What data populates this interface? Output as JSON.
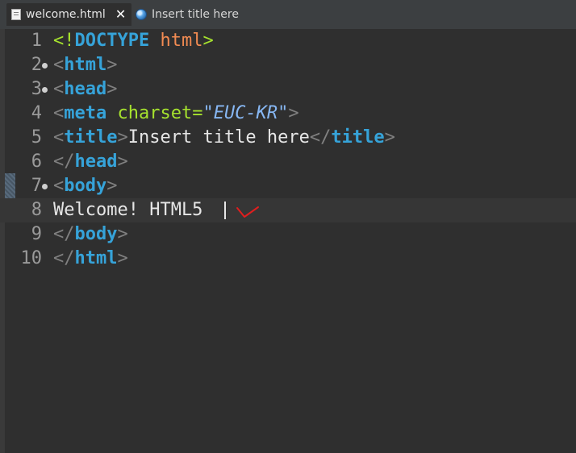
{
  "tabs": [
    {
      "label": "welcome.html",
      "active": true,
      "icon": "file-icon"
    },
    {
      "label": "Insert title here",
      "active": false,
      "icon": "globe-icon"
    }
  ],
  "editor": {
    "lines": [
      {
        "num": "1",
        "tokens": [
          [
            "c-bracket-green",
            "<!"
          ],
          [
            "c-tag",
            "DOCTYPE"
          ],
          [
            "c-text",
            " "
          ],
          [
            "c-kw-orange",
            "html"
          ],
          [
            "c-bracket-green",
            ">"
          ]
        ]
      },
      {
        "num": "2",
        "fold": true,
        "tokens": [
          [
            "c-bracket",
            "<"
          ],
          [
            "c-tag",
            "html"
          ],
          [
            "c-bracket",
            ">"
          ]
        ]
      },
      {
        "num": "3",
        "fold": true,
        "tokens": [
          [
            "c-bracket",
            "<"
          ],
          [
            "c-tag",
            "head"
          ],
          [
            "c-bracket",
            ">"
          ]
        ]
      },
      {
        "num": "4",
        "tokens": [
          [
            "c-bracket",
            "<"
          ],
          [
            "c-tag",
            "meta"
          ],
          [
            "c-text",
            " "
          ],
          [
            "c-attr",
            "charset"
          ],
          [
            "c-attr",
            "="
          ],
          [
            "c-val",
            "\"EUC-KR\""
          ],
          [
            "c-bracket",
            ">"
          ]
        ]
      },
      {
        "num": "5",
        "tokens": [
          [
            "c-bracket",
            "<"
          ],
          [
            "c-tag",
            "title"
          ],
          [
            "c-bracket",
            ">"
          ],
          [
            "c-text",
            "Insert title here"
          ],
          [
            "c-bracket",
            "</"
          ],
          [
            "c-tag",
            "title"
          ],
          [
            "c-bracket",
            ">"
          ]
        ]
      },
      {
        "num": "6",
        "tokens": [
          [
            "c-bracket",
            "</"
          ],
          [
            "c-tag",
            "head"
          ],
          [
            "c-bracket",
            ">"
          ]
        ]
      },
      {
        "num": "7",
        "fold": true,
        "tokens": [
          [
            "c-bracket",
            "<"
          ],
          [
            "c-tag",
            "body"
          ],
          [
            "c-bracket",
            ">"
          ]
        ]
      },
      {
        "num": "8",
        "highlight": true,
        "tokens": [
          [
            "c-text",
            "Welcome! HTML5"
          ]
        ]
      },
      {
        "num": "9",
        "tokens": [
          [
            "c-bracket",
            "</"
          ],
          [
            "c-tag",
            "body"
          ],
          [
            "c-bracket",
            ">"
          ]
        ]
      },
      {
        "num": "10",
        "tokens": [
          [
            "c-bracket",
            "</"
          ],
          [
            "c-tag",
            "html"
          ],
          [
            "c-bracket",
            ">"
          ]
        ]
      }
    ]
  },
  "colors": {
    "background": "#2f2f2f",
    "tag": "#36a3d9",
    "annotation_mark": "#e01e1e"
  }
}
